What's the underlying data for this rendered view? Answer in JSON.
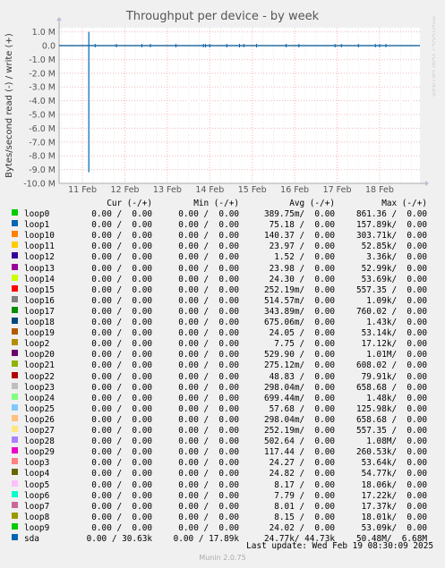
{
  "chart_data": {
    "type": "line",
    "title": "Throughput per device - by week",
    "ylabel": "Bytes/second read (-) / write (+)",
    "side_label": "RRDTOOL / TOBI OETIKER",
    "y_ticks": [
      "1.0 M",
      "0.0",
      "-1.0 M",
      "-2.0 M",
      "-3.0 M",
      "-4.0 M",
      "-5.0 M",
      "-6.0 M",
      "-7.0 M",
      "-8.0 M",
      "-9.0 M",
      "-10.0 M"
    ],
    "y_tick_values": [
      1,
      0,
      -1,
      -2,
      -3,
      -4,
      -5,
      -6,
      -7,
      -8,
      -9,
      -10
    ],
    "ylim": [
      -10,
      1.3
    ],
    "x_ticks": [
      "11 Feb",
      "12 Feb",
      "13 Feb",
      "14 Feb",
      "15 Feb",
      "16 Feb",
      "17 Feb",
      "18 Feb"
    ],
    "xlim_days": [
      10.45,
      18.95
    ],
    "grid": true,
    "series": [
      {
        "name": "sda",
        "color": "#0066B3",
        "spike": {
          "day": 11.15,
          "write_peak_M": 1.0,
          "read_peak_M": -9.2
        },
        "blips": [
          11.3,
          11.8,
          12.4,
          12.6,
          13.2,
          13.85,
          13.9,
          14.0,
          14.4,
          14.7,
          14.8,
          15.1,
          15.8,
          16.1,
          16.95,
          17.1,
          17.5,
          17.9,
          18.0,
          18.15
        ]
      }
    ]
  },
  "legend": {
    "headers": {
      "cur": "Cur (-/+)",
      "min": "Min (-/+)",
      "avg": "Avg (-/+)",
      "max": "Max (-/+)"
    },
    "rows": [
      {
        "name": "loop0",
        "color": "#00CC00",
        "cur": "0.00 /  0.00",
        "min": "0.00 /  0.00",
        "avg": "389.75m/  0.00",
        "max": "861.36 /  0.00"
      },
      {
        "name": "loop1",
        "color": "#0066B3",
        "cur": "0.00 /  0.00",
        "min": "0.00 /  0.00",
        "avg": "75.18 /  0.00",
        "max": "157.89k/  0.00"
      },
      {
        "name": "loop10",
        "color": "#FF8000",
        "cur": "0.00 /  0.00",
        "min": "0.00 /  0.00",
        "avg": "140.37 /  0.00",
        "max": "303.71k/  0.00"
      },
      {
        "name": "loop11",
        "color": "#FFCC00",
        "cur": "0.00 /  0.00",
        "min": "0.00 /  0.00",
        "avg": "23.97 /  0.00",
        "max": "52.85k/  0.00"
      },
      {
        "name": "loop12",
        "color": "#330099",
        "cur": "0.00 /  0.00",
        "min": "0.00 /  0.00",
        "avg": "1.52 /  0.00",
        "max": "3.36k/  0.00"
      },
      {
        "name": "loop13",
        "color": "#990099",
        "cur": "0.00 /  0.00",
        "min": "0.00 /  0.00",
        "avg": "23.98 /  0.00",
        "max": "52.99k/  0.00"
      },
      {
        "name": "loop14",
        "color": "#CCFF00",
        "cur": "0.00 /  0.00",
        "min": "0.00 /  0.00",
        "avg": "24.30 /  0.00",
        "max": "53.69k/  0.00"
      },
      {
        "name": "loop15",
        "color": "#FF0000",
        "cur": "0.00 /  0.00",
        "min": "0.00 /  0.00",
        "avg": "252.19m/  0.00",
        "max": "557.35 /  0.00"
      },
      {
        "name": "loop16",
        "color": "#808080",
        "cur": "0.00 /  0.00",
        "min": "0.00 /  0.00",
        "avg": "514.57m/  0.00",
        "max": "1.09k/  0.00"
      },
      {
        "name": "loop17",
        "color": "#008F00",
        "cur": "0.00 /  0.00",
        "min": "0.00 /  0.00",
        "avg": "343.89m/  0.00",
        "max": "760.02 /  0.00"
      },
      {
        "name": "loop18",
        "color": "#00487D",
        "cur": "0.00 /  0.00",
        "min": "0.00 /  0.00",
        "avg": "675.06m/  0.00",
        "max": "1.43k/  0.00"
      },
      {
        "name": "loop19",
        "color": "#B35A00",
        "cur": "0.00 /  0.00",
        "min": "0.00 /  0.00",
        "avg": "24.05 /  0.00",
        "max": "53.14k/  0.00"
      },
      {
        "name": "loop2",
        "color": "#B38F00",
        "cur": "0.00 /  0.00",
        "min": "0.00 /  0.00",
        "avg": "7.75 /  0.00",
        "max": "17.12k/  0.00"
      },
      {
        "name": "loop20",
        "color": "#6B006B",
        "cur": "0.00 /  0.00",
        "min": "0.00 /  0.00",
        "avg": "529.90 /  0.00",
        "max": "1.01M/  0.00"
      },
      {
        "name": "loop21",
        "color": "#8FB300",
        "cur": "0.00 /  0.00",
        "min": "0.00 /  0.00",
        "avg": "275.12m/  0.00",
        "max": "608.02 /  0.00"
      },
      {
        "name": "loop22",
        "color": "#B30000",
        "cur": "0.00 /  0.00",
        "min": "0.00 /  0.00",
        "avg": "48.83 /  0.00",
        "max": "79.91k/  0.00"
      },
      {
        "name": "loop23",
        "color": "#BEBEBE",
        "cur": "0.00 /  0.00",
        "min": "0.00 /  0.00",
        "avg": "298.04m/  0.00",
        "max": "658.68 /  0.00"
      },
      {
        "name": "loop24",
        "color": "#80FF80",
        "cur": "0.00 /  0.00",
        "min": "0.00 /  0.00",
        "avg": "699.44m/  0.00",
        "max": "1.48k/  0.00"
      },
      {
        "name": "loop25",
        "color": "#80C9FF",
        "cur": "0.00 /  0.00",
        "min": "0.00 /  0.00",
        "avg": "57.68 /  0.00",
        "max": "125.98k/  0.00"
      },
      {
        "name": "loop26",
        "color": "#FFC080",
        "cur": "0.00 /  0.00",
        "min": "0.00 /  0.00",
        "avg": "298.04m/  0.00",
        "max": "658.68 /  0.00"
      },
      {
        "name": "loop27",
        "color": "#FFE680",
        "cur": "0.00 /  0.00",
        "min": "0.00 /  0.00",
        "avg": "252.19m/  0.00",
        "max": "557.35 /  0.00"
      },
      {
        "name": "loop28",
        "color": "#AA80FF",
        "cur": "0.00 /  0.00",
        "min": "0.00 /  0.00",
        "avg": "502.64 /  0.00",
        "max": "1.08M/  0.00"
      },
      {
        "name": "loop29",
        "color": "#EE00CC",
        "cur": "0.00 /  0.00",
        "min": "0.00 /  0.00",
        "avg": "117.44 /  0.00",
        "max": "260.53k/  0.00"
      },
      {
        "name": "loop3",
        "color": "#FF8080",
        "cur": "0.00 /  0.00",
        "min": "0.00 /  0.00",
        "avg": "24.27 /  0.00",
        "max": "53.64k/  0.00"
      },
      {
        "name": "loop4",
        "color": "#666600",
        "cur": "0.00 /  0.00",
        "min": "0.00 /  0.00",
        "avg": "24.82 /  0.00",
        "max": "54.77k/  0.00"
      },
      {
        "name": "loop5",
        "color": "#FFBFFF",
        "cur": "0.00 /  0.00",
        "min": "0.00 /  0.00",
        "avg": "8.17 /  0.00",
        "max": "18.06k/  0.00"
      },
      {
        "name": "loop6",
        "color": "#00FFCC",
        "cur": "0.00 /  0.00",
        "min": "0.00 /  0.00",
        "avg": "7.79 /  0.00",
        "max": "17.22k/  0.00"
      },
      {
        "name": "loop7",
        "color": "#CC6699",
        "cur": "0.00 /  0.00",
        "min": "0.00 /  0.00",
        "avg": "8.01 /  0.00",
        "max": "17.37k/  0.00"
      },
      {
        "name": "loop8",
        "color": "#999900",
        "cur": "0.00 /  0.00",
        "min": "0.00 /  0.00",
        "avg": "8.15 /  0.00",
        "max": "18.01k/  0.00"
      },
      {
        "name": "loop9",
        "color": "#00CC00",
        "cur": "0.00 /  0.00",
        "min": "0.00 /  0.00",
        "avg": "24.02 /  0.00",
        "max": "53.09k/  0.00"
      },
      {
        "name": "sda",
        "color": "#0066B3",
        "cur": "0.00 / 30.63k",
        "min": "0.00 / 17.89k",
        "avg": "24.77k/ 44.73k",
        "max": "50.48M/  6.68M"
      }
    ]
  },
  "last_update": "Last update: Wed Feb 19 08:30:09 2025",
  "version": "Munin 2.0.75"
}
